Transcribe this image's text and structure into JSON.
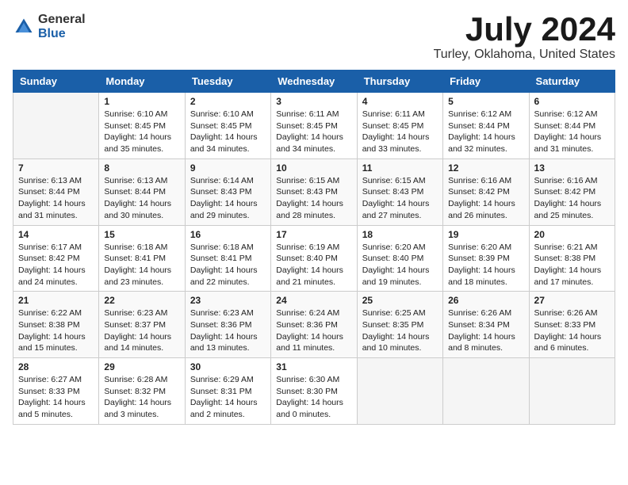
{
  "logo": {
    "general": "General",
    "blue": "Blue"
  },
  "title": "July 2024",
  "location": "Turley, Oklahoma, United States",
  "days_of_week": [
    "Sunday",
    "Monday",
    "Tuesday",
    "Wednesday",
    "Thursday",
    "Friday",
    "Saturday"
  ],
  "weeks": [
    [
      {
        "day": "",
        "info": ""
      },
      {
        "day": "1",
        "info": "Sunrise: 6:10 AM\nSunset: 8:45 PM\nDaylight: 14 hours\nand 35 minutes."
      },
      {
        "day": "2",
        "info": "Sunrise: 6:10 AM\nSunset: 8:45 PM\nDaylight: 14 hours\nand 34 minutes."
      },
      {
        "day": "3",
        "info": "Sunrise: 6:11 AM\nSunset: 8:45 PM\nDaylight: 14 hours\nand 34 minutes."
      },
      {
        "day": "4",
        "info": "Sunrise: 6:11 AM\nSunset: 8:45 PM\nDaylight: 14 hours\nand 33 minutes."
      },
      {
        "day": "5",
        "info": "Sunrise: 6:12 AM\nSunset: 8:44 PM\nDaylight: 14 hours\nand 32 minutes."
      },
      {
        "day": "6",
        "info": "Sunrise: 6:12 AM\nSunset: 8:44 PM\nDaylight: 14 hours\nand 31 minutes."
      }
    ],
    [
      {
        "day": "7",
        "info": "Sunrise: 6:13 AM\nSunset: 8:44 PM\nDaylight: 14 hours\nand 31 minutes."
      },
      {
        "day": "8",
        "info": "Sunrise: 6:13 AM\nSunset: 8:44 PM\nDaylight: 14 hours\nand 30 minutes."
      },
      {
        "day": "9",
        "info": "Sunrise: 6:14 AM\nSunset: 8:43 PM\nDaylight: 14 hours\nand 29 minutes."
      },
      {
        "day": "10",
        "info": "Sunrise: 6:15 AM\nSunset: 8:43 PM\nDaylight: 14 hours\nand 28 minutes."
      },
      {
        "day": "11",
        "info": "Sunrise: 6:15 AM\nSunset: 8:43 PM\nDaylight: 14 hours\nand 27 minutes."
      },
      {
        "day": "12",
        "info": "Sunrise: 6:16 AM\nSunset: 8:42 PM\nDaylight: 14 hours\nand 26 minutes."
      },
      {
        "day": "13",
        "info": "Sunrise: 6:16 AM\nSunset: 8:42 PM\nDaylight: 14 hours\nand 25 minutes."
      }
    ],
    [
      {
        "day": "14",
        "info": "Sunrise: 6:17 AM\nSunset: 8:42 PM\nDaylight: 14 hours\nand 24 minutes."
      },
      {
        "day": "15",
        "info": "Sunrise: 6:18 AM\nSunset: 8:41 PM\nDaylight: 14 hours\nand 23 minutes."
      },
      {
        "day": "16",
        "info": "Sunrise: 6:18 AM\nSunset: 8:41 PM\nDaylight: 14 hours\nand 22 minutes."
      },
      {
        "day": "17",
        "info": "Sunrise: 6:19 AM\nSunset: 8:40 PM\nDaylight: 14 hours\nand 21 minutes."
      },
      {
        "day": "18",
        "info": "Sunrise: 6:20 AM\nSunset: 8:40 PM\nDaylight: 14 hours\nand 19 minutes."
      },
      {
        "day": "19",
        "info": "Sunrise: 6:20 AM\nSunset: 8:39 PM\nDaylight: 14 hours\nand 18 minutes."
      },
      {
        "day": "20",
        "info": "Sunrise: 6:21 AM\nSunset: 8:38 PM\nDaylight: 14 hours\nand 17 minutes."
      }
    ],
    [
      {
        "day": "21",
        "info": "Sunrise: 6:22 AM\nSunset: 8:38 PM\nDaylight: 14 hours\nand 15 minutes."
      },
      {
        "day": "22",
        "info": "Sunrise: 6:23 AM\nSunset: 8:37 PM\nDaylight: 14 hours\nand 14 minutes."
      },
      {
        "day": "23",
        "info": "Sunrise: 6:23 AM\nSunset: 8:36 PM\nDaylight: 14 hours\nand 13 minutes."
      },
      {
        "day": "24",
        "info": "Sunrise: 6:24 AM\nSunset: 8:36 PM\nDaylight: 14 hours\nand 11 minutes."
      },
      {
        "day": "25",
        "info": "Sunrise: 6:25 AM\nSunset: 8:35 PM\nDaylight: 14 hours\nand 10 minutes."
      },
      {
        "day": "26",
        "info": "Sunrise: 6:26 AM\nSunset: 8:34 PM\nDaylight: 14 hours\nand 8 minutes."
      },
      {
        "day": "27",
        "info": "Sunrise: 6:26 AM\nSunset: 8:33 PM\nDaylight: 14 hours\nand 6 minutes."
      }
    ],
    [
      {
        "day": "28",
        "info": "Sunrise: 6:27 AM\nSunset: 8:33 PM\nDaylight: 14 hours\nand 5 minutes."
      },
      {
        "day": "29",
        "info": "Sunrise: 6:28 AM\nSunset: 8:32 PM\nDaylight: 14 hours\nand 3 minutes."
      },
      {
        "day": "30",
        "info": "Sunrise: 6:29 AM\nSunset: 8:31 PM\nDaylight: 14 hours\nand 2 minutes."
      },
      {
        "day": "31",
        "info": "Sunrise: 6:30 AM\nSunset: 8:30 PM\nDaylight: 14 hours\nand 0 minutes."
      },
      {
        "day": "",
        "info": ""
      },
      {
        "day": "",
        "info": ""
      },
      {
        "day": "",
        "info": ""
      }
    ]
  ]
}
